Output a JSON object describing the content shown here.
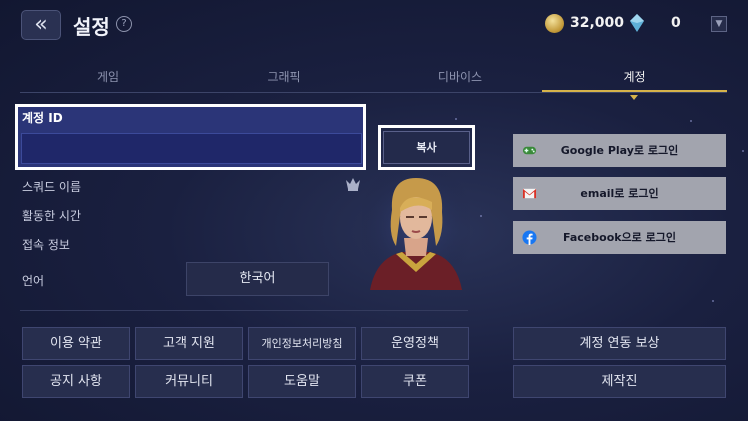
{
  "header": {
    "back_icon": "double-chevron-left-icon",
    "title": "설정",
    "help_glyph": "?",
    "gold": "32,000",
    "crystal": "0",
    "dropdown_glyph": "▼"
  },
  "tabs": [
    {
      "label": "게임",
      "active": false
    },
    {
      "label": "그래픽",
      "active": false
    },
    {
      "label": "디바이스",
      "active": false
    },
    {
      "label": "계정",
      "active": true
    }
  ],
  "account": {
    "id_label": "계정 ID",
    "id_value": "",
    "copy_label": "복사"
  },
  "info": {
    "squad_name": "스쿼드 이름",
    "active_time": "활동한 시간",
    "connection": "접속 정보",
    "language_label": "언어",
    "language_value": "한국어"
  },
  "grid": [
    [
      "이용 약관",
      "고객 지원",
      "개인정보처리방침",
      "운영정책"
    ],
    [
      "공지 사항",
      "커뮤니티",
      "도움말",
      "쿠폰"
    ]
  ],
  "login": {
    "google": "Google Play로 로그인",
    "email": "email로 로그인",
    "facebook": "Facebook으로 로그인"
  },
  "right_buttons": {
    "link_reward": "계정 연동 보상",
    "credits": "제작진"
  },
  "colors": {
    "accent": "#d6b34a",
    "id_box": "#2b3578",
    "login_button": "#a2a4ae"
  }
}
